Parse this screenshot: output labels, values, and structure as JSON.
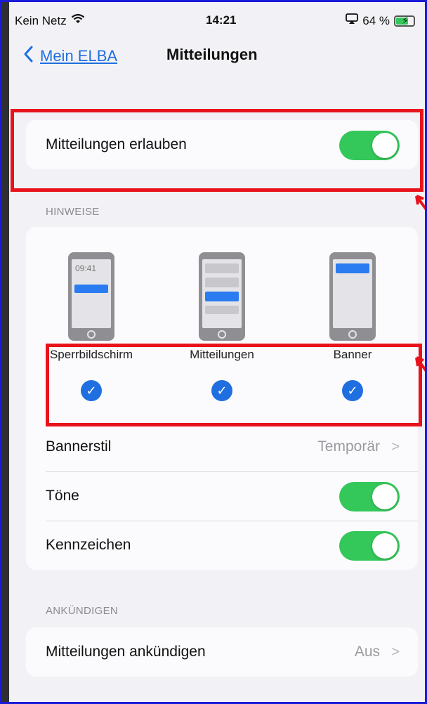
{
  "status": {
    "carrier": "Kein Netz",
    "time": "14:21",
    "battery": "64 %"
  },
  "nav": {
    "back_label": "Mein ELBA",
    "title": "Mitteilungen"
  },
  "allow": {
    "label": "Mitteilungen erlauben",
    "enabled": true
  },
  "alerts": {
    "header": "HINWEISE",
    "styles": [
      {
        "label": "Sperrbildschirm",
        "checked": true,
        "clock": "09:41"
      },
      {
        "label": "Mitteilungen",
        "checked": true
      },
      {
        "label": "Banner",
        "checked": true
      }
    ],
    "banner_style": {
      "label": "Bannerstil",
      "value": "Temporär"
    },
    "sounds": {
      "label": "Töne",
      "enabled": true
    },
    "badges": {
      "label": "Kennzeichen",
      "enabled": true
    }
  },
  "announce": {
    "header": "ANKÜNDIGEN",
    "row": {
      "label": "Mitteilungen ankündigen",
      "value": "Aus"
    }
  },
  "colors": {
    "accent": "#1f6fe0",
    "toggle_on": "#34c759",
    "highlight": "#e8131b"
  }
}
